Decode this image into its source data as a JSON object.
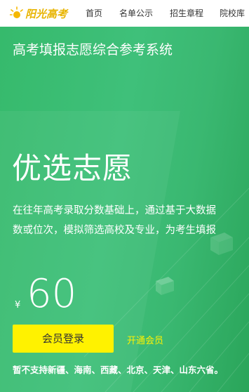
{
  "logo": {
    "text": "阳光高考",
    "color": "#e8b400"
  },
  "nav": [
    "首页",
    "名单公示",
    "招生章程",
    "院校库"
  ],
  "hero": {
    "system_title": "高考填报志愿综合参考系统",
    "title": "优选志愿",
    "desc_line1": "在往年高考录取分数基础上，通过基于大数据",
    "desc_line2": "数或位次，模拟筛选高校及专业，为考生填报",
    "currency": "¥",
    "price": "60",
    "login_label": "会员登录",
    "open_label": "开通会员",
    "note": "暂不支持新疆、海南、西藏、北京、天津、山东六省。",
    "bg_color": "#3cbd74",
    "button_color": "#fff200"
  }
}
